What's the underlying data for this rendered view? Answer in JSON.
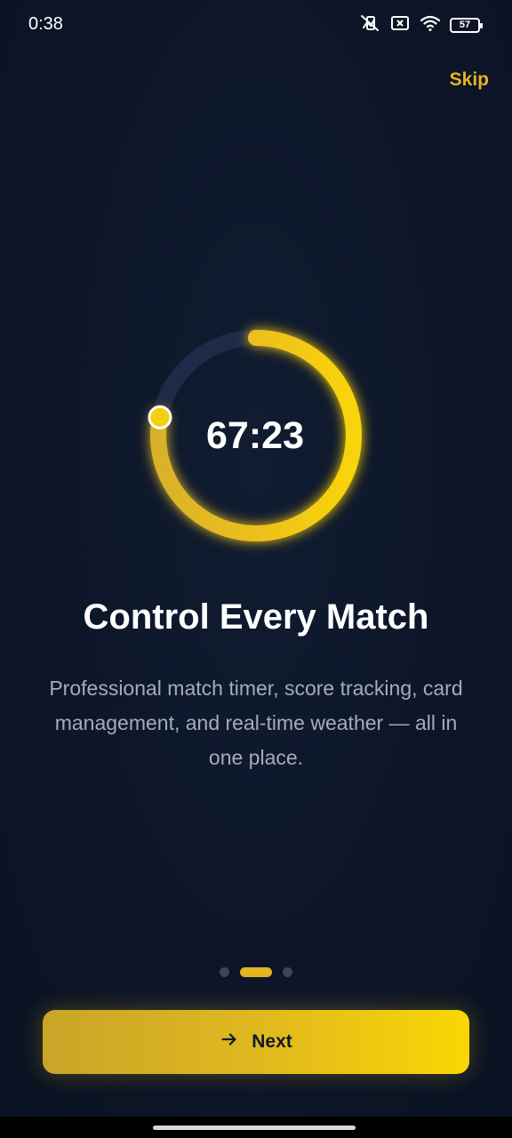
{
  "status_bar": {
    "time": "0:38",
    "battery_level": "57",
    "icons": [
      "vibrate-off-icon",
      "no-sim-icon",
      "wifi-icon",
      "battery-icon"
    ]
  },
  "skip_label": "Skip",
  "timer": {
    "display": "67:23",
    "progress_fraction": 0.78,
    "track_color": "#1e2a47",
    "progress_color": "#f5cf10",
    "knob_color": "#f5cf10"
  },
  "onboarding": {
    "title": "Control Every Match",
    "description": "Professional match timer, score tracking, card management, and real-time weather — all in one place.",
    "page_count": 3,
    "active_page": 2
  },
  "next_button": {
    "label": "Next",
    "icon": "arrow-right-icon"
  },
  "colors": {
    "background": "#0c1526",
    "accent": "#e3b521",
    "text_primary": "#ffffff",
    "text_secondary": "#a4acbb"
  }
}
